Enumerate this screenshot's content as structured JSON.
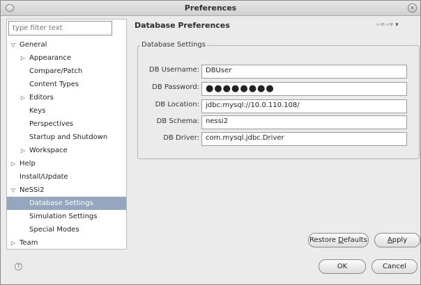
{
  "window": {
    "title": "Preferences"
  },
  "filter": {
    "placeholder": "type filter text"
  },
  "tree": [
    {
      "label": "General",
      "indent": 0,
      "toggle": "expanded"
    },
    {
      "label": "Appearance",
      "indent": 1,
      "toggle": "collapsed"
    },
    {
      "label": "Compare/Patch",
      "indent": 1,
      "toggle": "none"
    },
    {
      "label": "Content Types",
      "indent": 1,
      "toggle": "none"
    },
    {
      "label": "Editors",
      "indent": 1,
      "toggle": "collapsed"
    },
    {
      "label": "Keys",
      "indent": 1,
      "toggle": "none"
    },
    {
      "label": "Perspectives",
      "indent": 1,
      "toggle": "none"
    },
    {
      "label": "Startup and Shutdown",
      "indent": 1,
      "toggle": "none"
    },
    {
      "label": "Workspace",
      "indent": 1,
      "toggle": "collapsed"
    },
    {
      "label": "Help",
      "indent": 0,
      "toggle": "collapsed"
    },
    {
      "label": "Install/Update",
      "indent": 0,
      "toggle": "none"
    },
    {
      "label": "NeSSi2",
      "indent": 0,
      "toggle": "expanded"
    },
    {
      "label": "Database Settings",
      "indent": 1,
      "toggle": "none",
      "selected": true
    },
    {
      "label": "Simulation Settings",
      "indent": 1,
      "toggle": "none"
    },
    {
      "label": "Special Modes",
      "indent": 1,
      "toggle": "none"
    },
    {
      "label": "Team",
      "indent": 0,
      "toggle": "collapsed"
    }
  ],
  "page": {
    "title": "Database Preferences",
    "group_label": "Database Settings",
    "fields": {
      "username": {
        "label": "DB Username:",
        "value": "DBUser"
      },
      "password": {
        "label": "DB Password:",
        "value": "●●●●●●●●"
      },
      "location": {
        "label": "DB Location:",
        "value": "jdbc:mysql://10.0.110.108/"
      },
      "schema": {
        "label": "DB Schema:",
        "value": "nessi2"
      },
      "driver": {
        "label": "DB Driver:",
        "value": "com.mysql.jdbc.Driver"
      }
    }
  },
  "buttons": {
    "restore_defaults": {
      "pre": "Restore ",
      "mnemonic": "D",
      "post": "efaults"
    },
    "apply": {
      "mnemonic": "A",
      "post": "pply"
    },
    "ok": "OK",
    "cancel": "Cancel"
  },
  "icons": {
    "back": "back-arrow-icon",
    "forward": "forward-arrow-icon",
    "menu": "view-menu-icon",
    "help": "help-icon"
  },
  "colors": {
    "selection": "#94a7be",
    "window_bg": "#ebebeb"
  }
}
